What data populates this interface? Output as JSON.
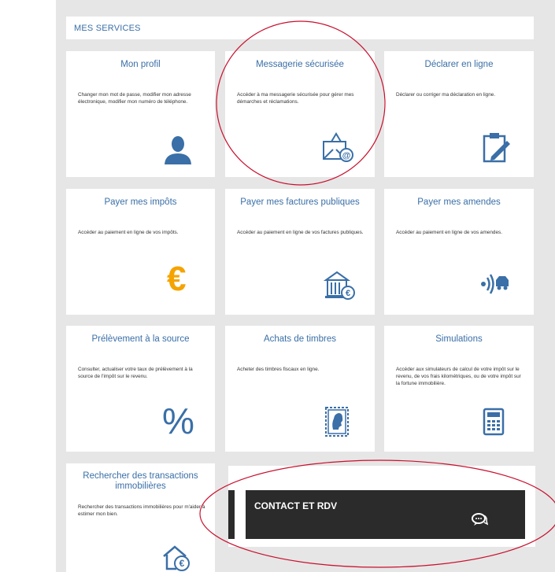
{
  "header": {
    "title": "MES SERVICES"
  },
  "cards": [
    {
      "title": "Mon profil",
      "desc": "Changer mon mot de passe, modifier mon adresse électronique, modifier mon numéro de téléphone."
    },
    {
      "title": "Messagerie sécurisée",
      "desc": "Accéder à ma messagerie sécurisée pour gérer mes démarches et réclamations."
    },
    {
      "title": "Déclarer en ligne",
      "desc": "Déclarer ou corriger ma déclaration en ligne."
    },
    {
      "title": "Payer mes impôts",
      "desc": "Accéder au paiement en ligne de vos impôts."
    },
    {
      "title": "Payer mes factures publiques",
      "desc": "Accéder au paiement en ligne de vos factures publiques."
    },
    {
      "title": "Payer mes amendes",
      "desc": "Accéder au paiement en ligne de vos amendes."
    },
    {
      "title": "Prélèvement à la source",
      "desc": "Consulter, actualiser votre taux de prélèvement à la source de l'impôt sur le revenu."
    },
    {
      "title": "Achats de timbres",
      "desc": "Acheter des timbres fiscaux en ligne."
    },
    {
      "title": "Simulations",
      "desc": "Accéder aux simulateurs de calcul de votre impôt sur le revenu, de vos frais kilométriques, ou de votre impôt sur la fortune immobilière."
    },
    {
      "title": "Rechercher des transactions immobilières",
      "desc": "Rechercher des transactions immobilières pour m'aider à estimer mon bien."
    }
  ],
  "icons": {
    "euro": "€",
    "percent": "%"
  },
  "contact": {
    "label": "CONTACT ET RDV"
  },
  "colors": {
    "accent": "#3a6fa7",
    "euro": "#f5a300",
    "dark": "#2b2b2b",
    "annotation": "#c8102e"
  }
}
